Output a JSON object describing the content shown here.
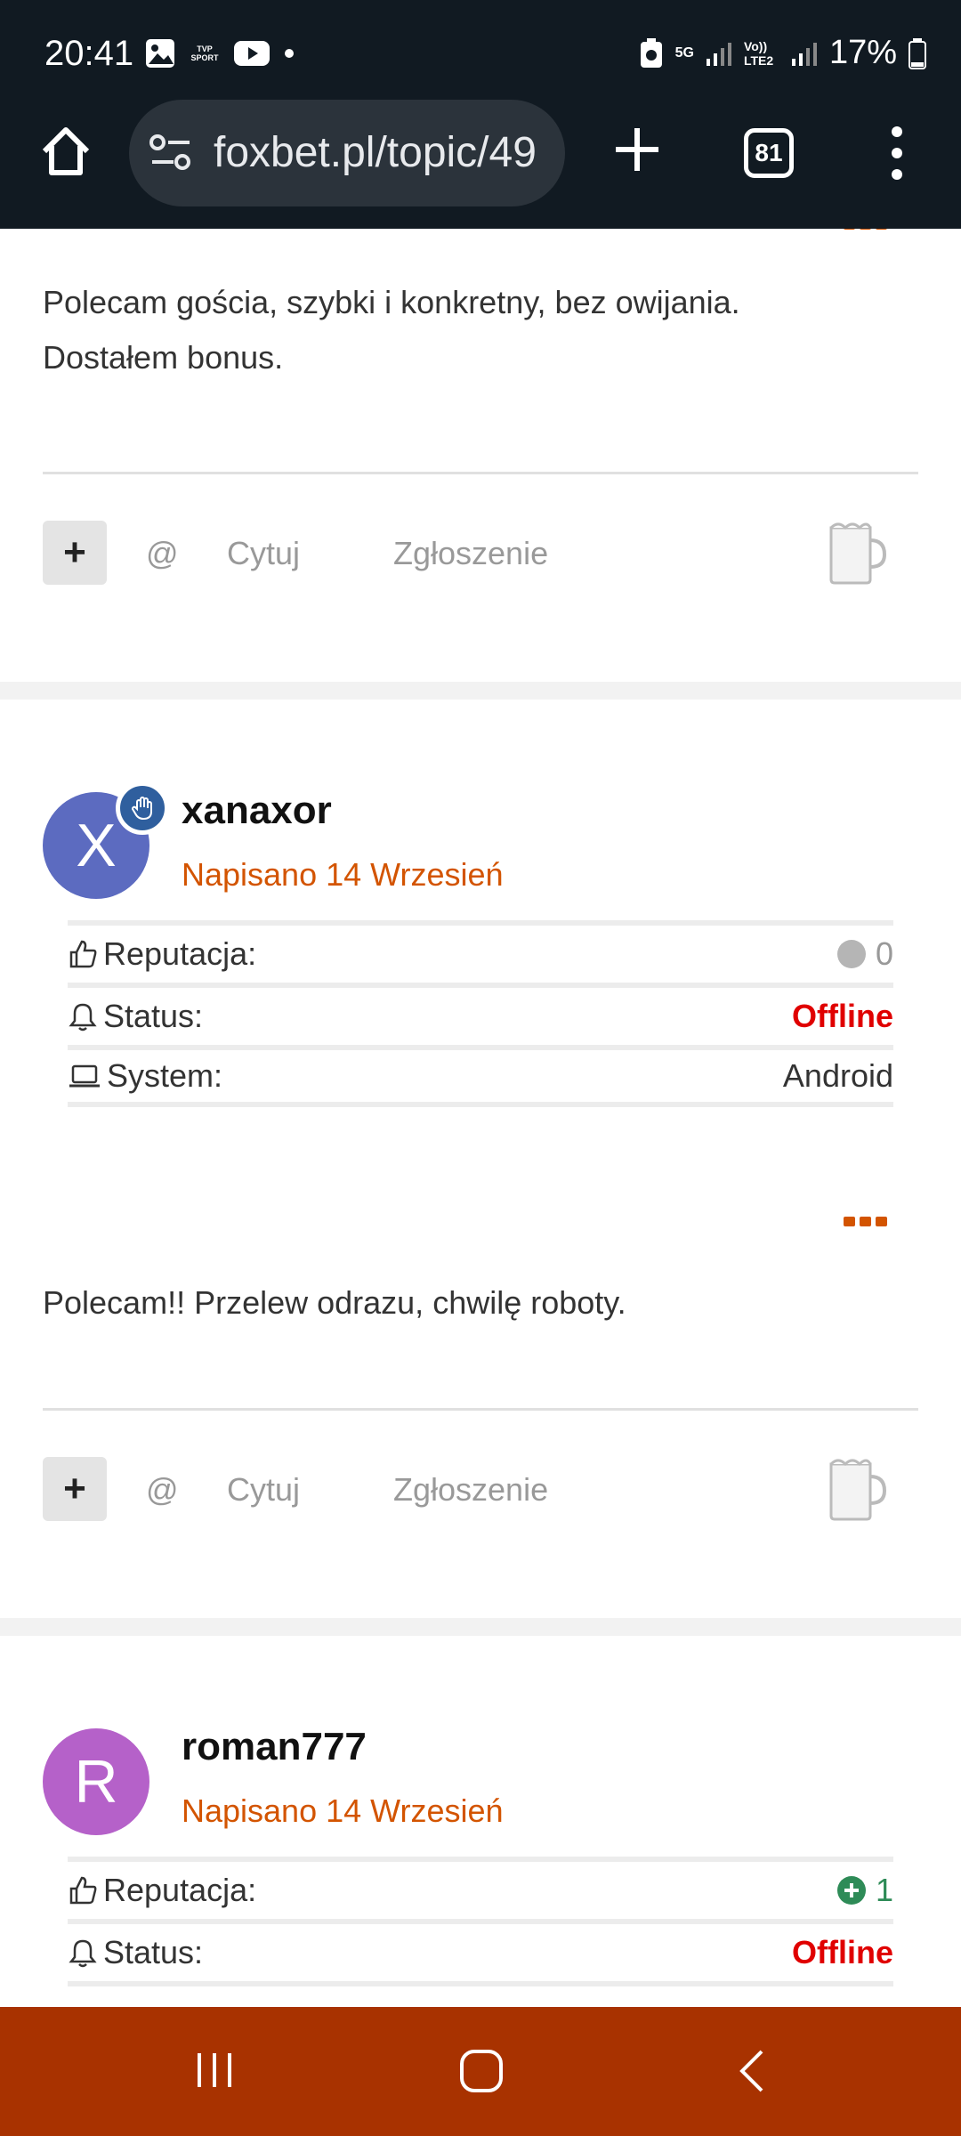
{
  "status_bar": {
    "time": "20:41",
    "network": "5G",
    "lte": "Vo)) LTE2",
    "battery": "17%",
    "tvp_label": "TVP SPORT"
  },
  "browser": {
    "url": "foxbet.pl/topic/49",
    "tab_count": "81"
  },
  "posts": [
    {
      "text_lines": [
        "Polecam gościa,  szybki i konkretny, bez owijania.",
        "Dostałem bonus."
      ],
      "actions": {
        "plus": "+",
        "mention": "@",
        "quote": "Cytuj",
        "report": "Zgłoszenie"
      }
    },
    {
      "avatar_letter": "X",
      "avatar_color": "#5c6bc0",
      "username": "xanaxor",
      "date": "Napisano 14 Wrzesień",
      "info": {
        "reputation_label": "Reputacja:",
        "reputation_value": "0",
        "status_label": "Status:",
        "status_value": "Offline",
        "system_label": "System:",
        "system_value": "Android"
      },
      "text": "Polecam!! Przelew odrazu, chwilę roboty.",
      "actions": {
        "plus": "+",
        "mention": "@",
        "quote": "Cytuj",
        "report": "Zgłoszenie"
      }
    },
    {
      "avatar_letter": "R",
      "avatar_color": "#b561c9",
      "username": "roman777",
      "date": "Napisano 14 Wrzesień",
      "info": {
        "reputation_label": "Reputacja:",
        "reputation_value": "1",
        "status_label": "Status:",
        "status_value": "Offline"
      }
    }
  ],
  "colors": {
    "accent": "#d35400",
    "offline": "#e00000",
    "rep_positive": "#2e8b57",
    "navbar": "#a83200"
  }
}
